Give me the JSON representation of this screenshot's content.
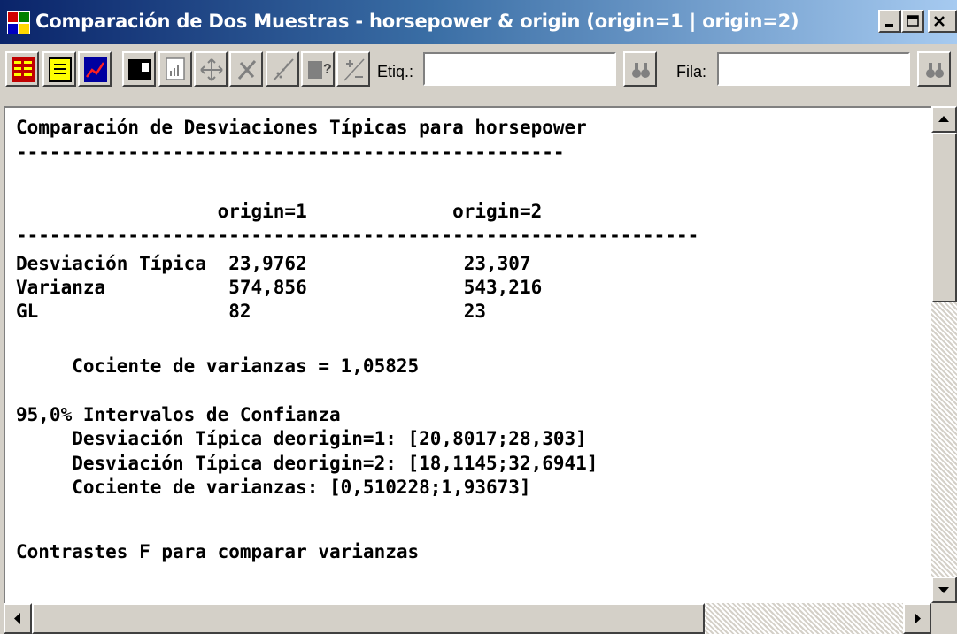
{
  "window": {
    "title": "Comparación de Dos Muestras - horsepower & origin (origin=1 | origin=2)",
    "controls": [
      "minimize-icon",
      "maximize-icon",
      "close-icon"
    ]
  },
  "toolbar": {
    "buttons": [
      "tabular-options-icon",
      "text-report-icon",
      "graph-icon",
      "save-results-icon",
      "copy-text-icon",
      "pane-options-icon",
      "analysis-options-icon",
      "graph-options-icon",
      "help-icon",
      "plus-minus-icon"
    ],
    "etiq_label": "Etiq.:",
    "etiq_value": "",
    "fila_label": "Fila:",
    "fila_value": "",
    "search_icon": "binoculars-icon"
  },
  "report": {
    "heading": "Comparación de Desviaciones Típicas para horsepower",
    "underline1": "-------------------------------------------------",
    "col_header": "                  origin=1             origin=2",
    "underline2": "-------------------------------------------------------------",
    "row_sd": "Desviación Típica  23,9762              23,307",
    "row_var": "Varianza           574,856              543,216",
    "row_gl": "GL                 82                   23",
    "ratio": "     Cociente de varianzas = 1,05825",
    "ci_title": "95,0% Intervalos de Confianza",
    "ci_sd1": "     Desviación Típica deorigin=1: [20,8017;28,303]",
    "ci_sd2": "     Desviación Típica deorigin=2: [18,1145;32,6941]",
    "ci_ratio": "     Cociente de varianzas: [0,510228;1,93673]",
    "ftest_title": "Contrastes F para comparar varianzas"
  },
  "colors": {
    "title_gradient_start": "#0a246a",
    "title_gradient_end": "#a6caf0",
    "face": "#d4d0c8",
    "content_bg": "#ffffff"
  }
}
